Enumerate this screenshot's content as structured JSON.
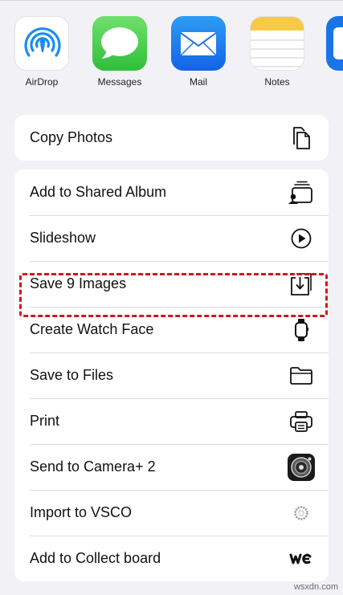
{
  "apps": [
    {
      "label": "AirDrop",
      "icon": "airdrop-icon"
    },
    {
      "label": "Messages",
      "icon": "messages-icon"
    },
    {
      "label": "Mail",
      "icon": "mail-icon"
    },
    {
      "label": "Notes",
      "icon": "notes-icon"
    },
    {
      "label": "",
      "icon": "app-icon"
    }
  ],
  "actions_group1": [
    {
      "label": "Copy Photos",
      "icon": "copy-icon"
    }
  ],
  "actions_group2": [
    {
      "label": "Add to Shared Album",
      "icon": "shared-album-icon"
    },
    {
      "label": "Slideshow",
      "icon": "play-circle-icon"
    },
    {
      "label": "Save 9 Images",
      "icon": "save-download-icon",
      "highlighted": true
    },
    {
      "label": "Create Watch Face",
      "icon": "watch-icon"
    },
    {
      "label": "Save to Files",
      "icon": "folder-icon"
    },
    {
      "label": "Print",
      "icon": "printer-icon"
    },
    {
      "label": "Send to Camera+ 2",
      "icon": "camera-plus-icon"
    },
    {
      "label": "Import to VSCO",
      "icon": "vsco-icon"
    },
    {
      "label": "Add to Collect board",
      "icon": "collect-icon"
    }
  ],
  "highlight_color": "#d6141c",
  "watermark": "wsxdn.com"
}
